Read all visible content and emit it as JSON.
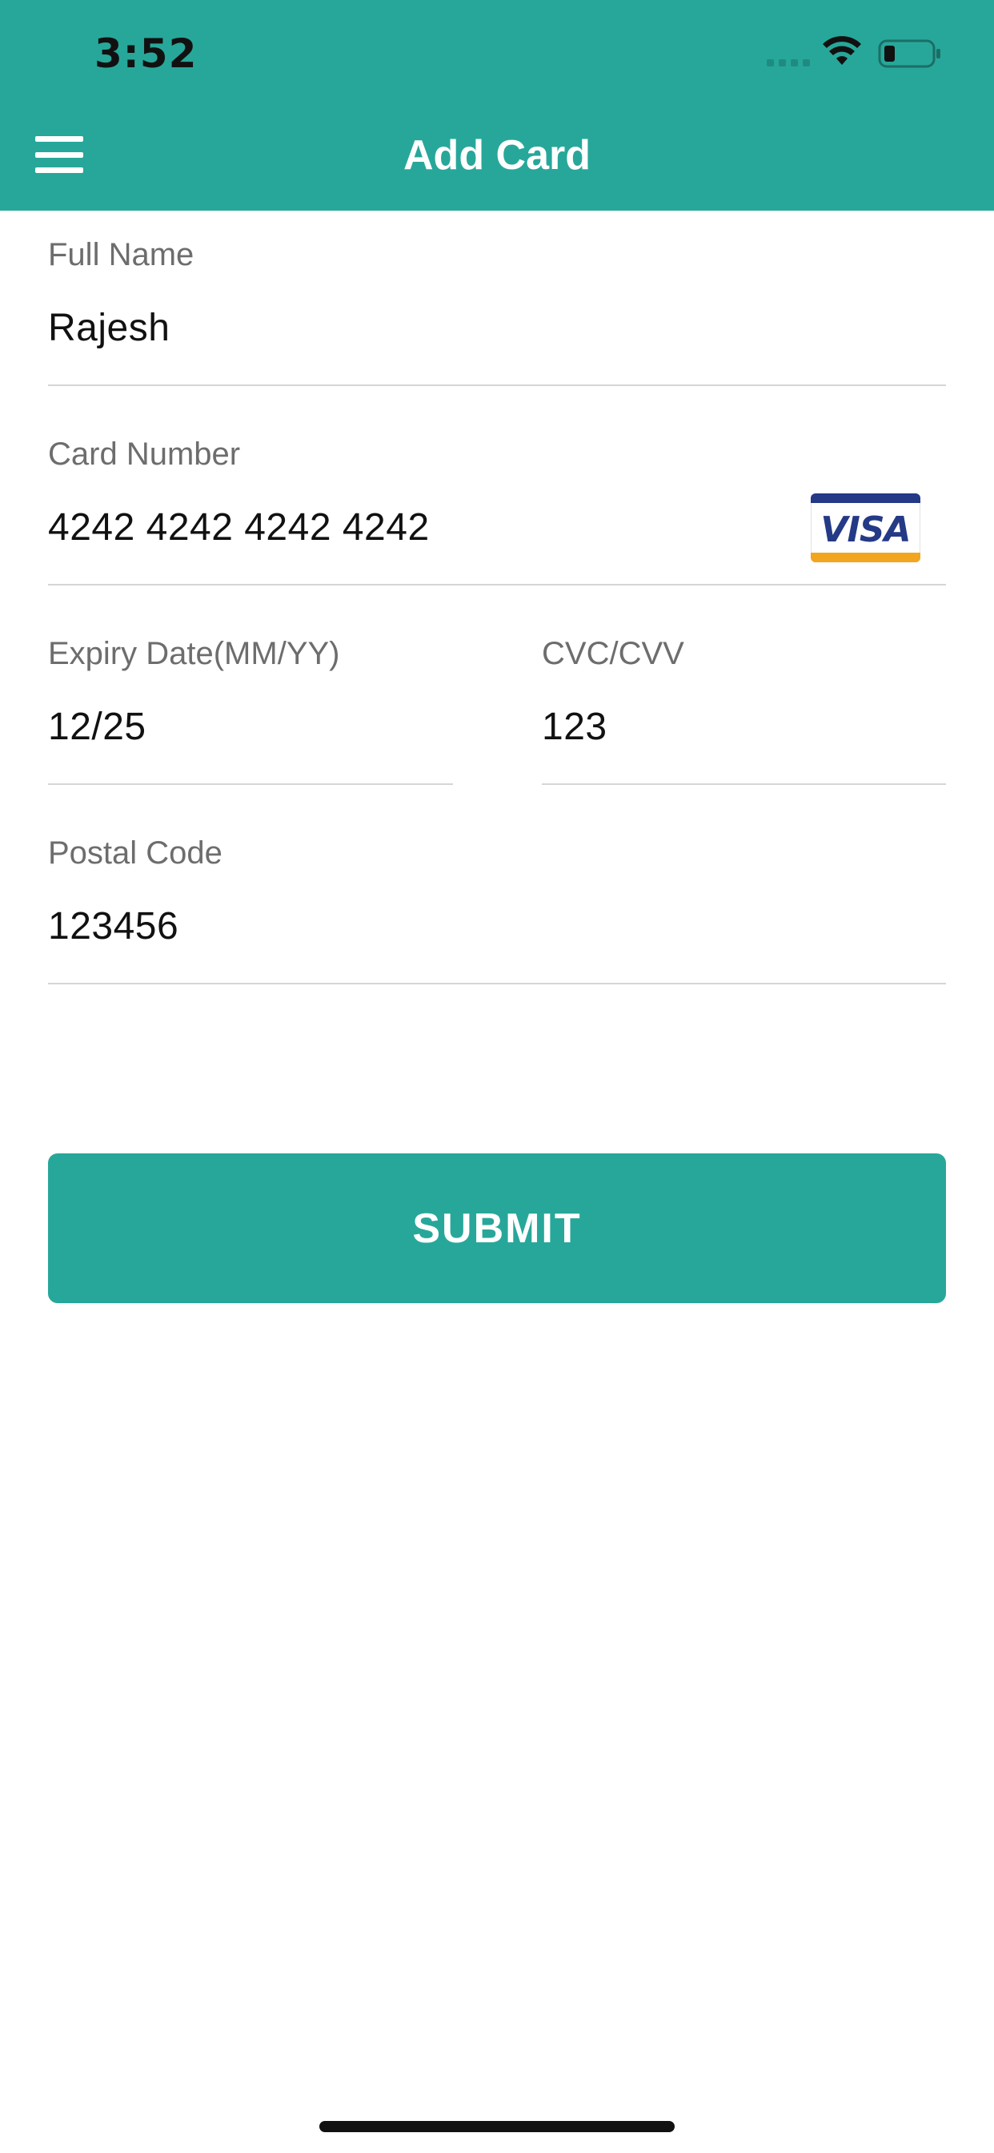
{
  "status_bar": {
    "time": "3:52"
  },
  "nav_bar": {
    "title": "Add Card",
    "menu_icon": "hamburger-menu-icon"
  },
  "form": {
    "full_name": {
      "label": "Full Name",
      "value": "Rajesh"
    },
    "card_number": {
      "label": "Card Number",
      "value": "4242 4242 4242 4242",
      "brand_logo": "VISA"
    },
    "expiry_date": {
      "label": "Expiry Date(MM/YY)",
      "value": "12/25"
    },
    "cvc": {
      "label": "CVC/CVV",
      "value": "123"
    },
    "postal_code": {
      "label": "Postal Code",
      "value": "123456"
    }
  },
  "submit": {
    "label": "SUBMIT"
  },
  "colors": {
    "accent": "#27a79a",
    "label_text": "#6d6d6d",
    "value_text": "#111111",
    "divider": "#d5d5d5",
    "visa_blue": "#243a86",
    "visa_gold": "#f2a51f"
  }
}
